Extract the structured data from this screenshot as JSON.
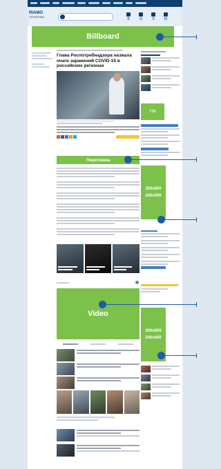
{
  "header": {
    "logo_line1": "RIAMO",
    "logo_line2": "ПОЛИТИКА",
    "icons": [
      {
        "name": "profile-icon",
        "label": "В"
      },
      {
        "name": "bookmark-icon",
        "label": "И"
      },
      {
        "name": "user-icon",
        "label": "Л"
      },
      {
        "name": "menu-icon",
        "label": "М"
      }
    ]
  },
  "placements": {
    "billboard": "Billboard",
    "peretyazhka": "Перетяжка",
    "video": "Video",
    "ad1_line1": "300x600",
    "ad1_line2": "240x400",
    "ad2_line1": "300x600",
    "ad2_line2": "240x400",
    "side_banner": "TTE"
  },
  "article": {
    "title": "Глава Роспотребнадзора назвала очаги заражений COVID-19 в российских регионах"
  },
  "colors": {
    "ad_placeholder": "#7cc149",
    "brand": "#0e3f6e",
    "marker": "#1f5aa6",
    "accent_yellow": "#f5c430"
  }
}
